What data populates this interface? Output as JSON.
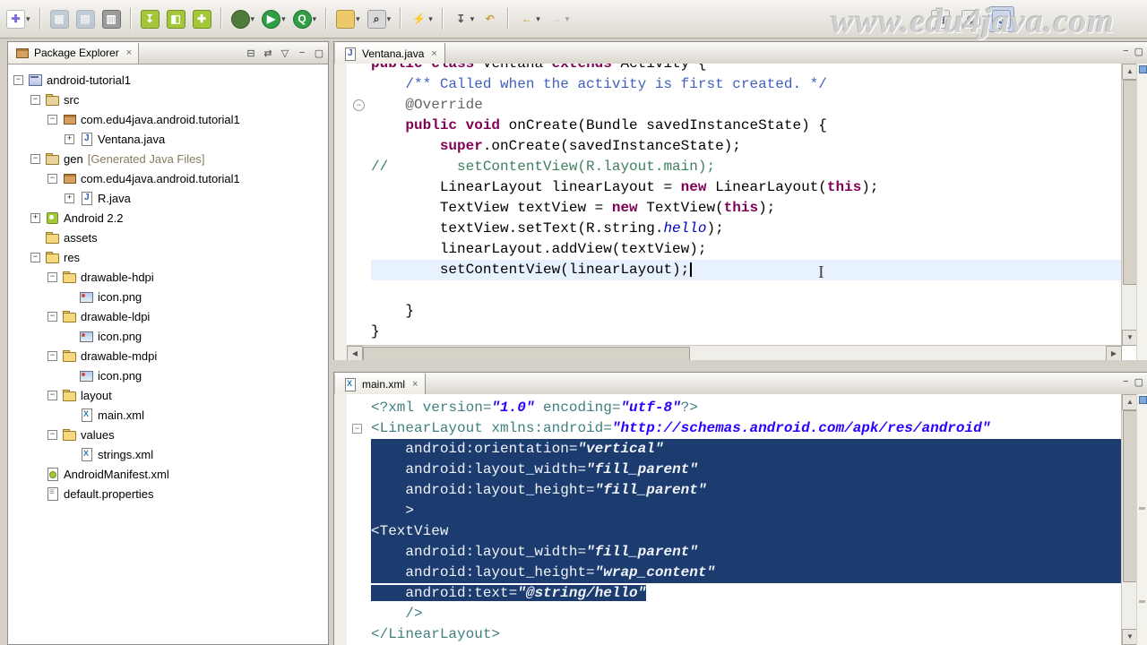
{
  "watermark": "www.edu4java.com",
  "palette": {
    "keyword": "#7f0055",
    "comment": "#3f7f5f",
    "javadoc": "#3f5fbf",
    "annotation": "#646464",
    "field": "#0000c0",
    "xml_tag": "#3f7f7f",
    "xml_attr": "#3f7f7f",
    "xml_value": "#2a00ff",
    "selection_bg": "#1c3b6e",
    "current_line": "#e8f2fe",
    "android_green": "#a4c639",
    "run_green": "#2f9e44"
  },
  "toolbar": {
    "items": [
      {
        "name": "new-wizard",
        "glyph": "✚",
        "fg": "#7a6ad8",
        "bg": "#ffffff",
        "dropdown": true
      },
      {
        "sep": true
      },
      {
        "name": "save",
        "glyph": "▦",
        "fg": "#ffffff",
        "bg": "#8fa8c8",
        "disabled": true
      },
      {
        "name": "save-all",
        "glyph": "▤",
        "fg": "#ffffff",
        "bg": "#8fa8c8",
        "disabled": true
      },
      {
        "name": "print",
        "glyph": "▥",
        "fg": "#ffffff",
        "bg": "#9b9b9b"
      },
      {
        "sep": true
      },
      {
        "name": "android-sdk-manager",
        "glyph": "↧",
        "fg": "#ffffff",
        "bg": "#a4c639"
      },
      {
        "name": "android-ddms",
        "glyph": "◧",
        "fg": "#ffffff",
        "bg": "#a4c639"
      },
      {
        "name": "new-android-project",
        "glyph": "✚",
        "fg": "#ffffff",
        "bg": "#a4c639"
      },
      {
        "sep": true
      },
      {
        "name": "debug",
        "glyph": "",
        "fg": "#ffffff",
        "bg": "#4e7b3a",
        "round": true,
        "dropdown": true
      },
      {
        "name": "run",
        "glyph": "▶",
        "fg": "#ffffff",
        "bg": "#2f9e44",
        "round": true,
        "dropdown": true
      },
      {
        "name": "run-history",
        "glyph": "Q",
        "fg": "#ffffff",
        "bg": "#2f9e44",
        "round": true,
        "dropdown": true
      },
      {
        "sep": true
      },
      {
        "name": "open-resource",
        "glyph": "",
        "fg": "#7a5c20",
        "bg": "#eec96a",
        "dropdown": true
      },
      {
        "name": "search",
        "glyph": "⌕",
        "fg": "#333333",
        "bg": "#d9d9d9",
        "dropdown": true
      },
      {
        "sep": true
      },
      {
        "name": "external-tools",
        "glyph": "⚡",
        "fg": "#dfa511",
        "bg": "none",
        "dropdown": true
      },
      {
        "sep": true
      },
      {
        "name": "next-annotation",
        "glyph": "↧",
        "fg": "#555555",
        "bg": "none",
        "dropdown": true
      },
      {
        "name": "last-edit-location",
        "glyph": "↶",
        "fg": "#c8a23a",
        "bg": "none"
      },
      {
        "sep": true
      },
      {
        "name": "back",
        "glyph": "←",
        "fg": "#c8941e",
        "bg": "none",
        "dropdown": true
      },
      {
        "name": "forward",
        "glyph": "→",
        "fg": "#b0b0b0",
        "bg": "none",
        "dropdown": true,
        "disabled": true
      }
    ],
    "right_items": [
      {
        "name": "open-perspective",
        "glyph": "⊞",
        "fg": "#44507a",
        "bg": "#eceae4"
      },
      {
        "name": "preferences",
        "glyph": "⚙",
        "fg": "#555f78",
        "bg": "#eceae4"
      },
      {
        "name": "java-perspective",
        "glyph": "J",
        "fg": "#1f4fa0",
        "bg": "#ccd7eb",
        "active": true
      }
    ]
  },
  "package_explorer": {
    "title": "Package Explorer",
    "close_glyph": "×",
    "header_icons": [
      {
        "name": "collapse-all",
        "glyph": "⊟"
      },
      {
        "name": "link-with-editor",
        "glyph": "⇄"
      },
      {
        "name": "view-menu",
        "glyph": "▽"
      },
      {
        "name": "minimize",
        "glyph": "−"
      },
      {
        "name": "maximize",
        "glyph": "▢"
      }
    ],
    "tree": [
      {
        "label": "android-tutorial1",
        "level": 0,
        "expander": "minus",
        "icon": "project"
      },
      {
        "label": "src",
        "level": 1,
        "expander": "minus",
        "icon": "srcfolder"
      },
      {
        "label": "com.edu4java.android.tutorial1",
        "level": 2,
        "expander": "minus",
        "icon": "package"
      },
      {
        "label": "Ventana.java",
        "level": 3,
        "expander": "plus",
        "icon": "java"
      },
      {
        "label": "gen",
        "suffix": "[Generated Java Files]",
        "level": 1,
        "expander": "minus",
        "icon": "srcfolder"
      },
      {
        "label": "com.edu4java.android.tutorial1",
        "level": 2,
        "expander": "minus",
        "icon": "package"
      },
      {
        "label": "R.java",
        "level": 3,
        "expander": "plus",
        "icon": "java"
      },
      {
        "label": "Android 2.2",
        "level": 1,
        "expander": "plus",
        "icon": "androidlib"
      },
      {
        "label": "assets",
        "level": 1,
        "expander": "none",
        "icon": "folder"
      },
      {
        "label": "res",
        "level": 1,
        "expander": "minus",
        "icon": "folder"
      },
      {
        "label": "drawable-hdpi",
        "level": 2,
        "expander": "minus",
        "icon": "folder"
      },
      {
        "label": "icon.png",
        "level": 3,
        "expander": "none",
        "icon": "image"
      },
      {
        "label": "drawable-ldpi",
        "level": 2,
        "expander": "minus",
        "icon": "folder"
      },
      {
        "label": "icon.png",
        "level": 3,
        "expander": "none",
        "icon": "image"
      },
      {
        "label": "drawable-mdpi",
        "level": 2,
        "expander": "minus",
        "icon": "folder"
      },
      {
        "label": "icon.png",
        "level": 3,
        "expander": "none",
        "icon": "image"
      },
      {
        "label": "layout",
        "level": 2,
        "expander": "minus",
        "icon": "folder"
      },
      {
        "label": "main.xml",
        "level": 3,
        "expander": "none",
        "icon": "xml"
      },
      {
        "label": "values",
        "level": 2,
        "expander": "minus",
        "icon": "folder"
      },
      {
        "label": "strings.xml",
        "level": 3,
        "expander": "none",
        "icon": "xml"
      },
      {
        "label": "AndroidManifest.xml",
        "level": 1,
        "expander": "none",
        "icon": "manifest"
      },
      {
        "label": "default.properties",
        "level": 1,
        "expander": "none",
        "icon": "properties"
      }
    ]
  },
  "java_editor": {
    "tab_label": "Ventana.java",
    "lines": [
      {
        "t": [
          [
            "kw",
            "public"
          ],
          [
            "p",
            " "
          ],
          [
            "kw",
            "class"
          ],
          [
            "p",
            " Ventana "
          ],
          [
            "kw",
            "extends"
          ],
          [
            "p",
            " Activity {"
          ]
        ]
      },
      {
        "t": [
          [
            "doc",
            "    /** Called when the activity is first created. */"
          ]
        ]
      },
      {
        "t": [
          [
            "ann",
            "    @Override"
          ]
        ],
        "fold": true
      },
      {
        "t": [
          [
            "p",
            "    "
          ],
          [
            "kw",
            "public"
          ],
          [
            "p",
            " "
          ],
          [
            "kw",
            "void"
          ],
          [
            "p",
            " onCreate(Bundle savedInstanceState) {"
          ]
        ],
        "marker": "arrow"
      },
      {
        "t": [
          [
            "p",
            "        "
          ],
          [
            "kw",
            "super"
          ],
          [
            "p",
            ".onCreate(savedInstanceState);"
          ]
        ]
      },
      {
        "t": [
          [
            "cmt",
            "//        setContentView(R.layout.main);"
          ]
        ]
      },
      {
        "t": [
          [
            "p",
            "        LinearLayout linearLayout = "
          ],
          [
            "kw",
            "new"
          ],
          [
            "p",
            " LinearLayout("
          ],
          [
            "kw",
            "this"
          ],
          [
            "p",
            ");"
          ]
        ]
      },
      {
        "t": [
          [
            "p",
            "        TextView textView = "
          ],
          [
            "kw",
            "new"
          ],
          [
            "p",
            " TextView("
          ],
          [
            "kw",
            "this"
          ],
          [
            "p",
            ");"
          ]
        ]
      },
      {
        "t": [
          [
            "p",
            "        textView.setText(R.string."
          ],
          [
            "fld",
            "hello"
          ],
          [
            "p",
            ");"
          ]
        ]
      },
      {
        "t": [
          [
            "p",
            "        linearLayout.addView(textView);"
          ]
        ]
      },
      {
        "t": [
          [
            "p",
            "        setContentView(linearLayout);"
          ]
        ],
        "current": true,
        "caret": true
      },
      {
        "t": [
          [
            "p",
            ""
          ]
        ]
      },
      {
        "t": [
          [
            "p",
            "    }"
          ]
        ]
      },
      {
        "t": [
          [
            "p",
            "}"
          ]
        ]
      }
    ]
  },
  "xml_editor": {
    "tab_label": "main.xml",
    "lines": [
      {
        "t": [
          [
            "tag",
            "<?xml "
          ],
          [
            "attr",
            "version="
          ],
          [
            "val",
            "\"1.0\""
          ],
          [
            "attr",
            " encoding="
          ],
          [
            "val",
            "\"utf-8\""
          ],
          [
            "tag",
            "?>"
          ]
        ]
      },
      {
        "t": [
          [
            "tag",
            "<LinearLayout "
          ],
          [
            "attr",
            "xmlns:android="
          ],
          [
            "val",
            "\"http://schemas.android.com/apk/res/android\""
          ]
        ],
        "fold": true
      },
      {
        "t": [
          [
            "attr",
            "    android:orientation="
          ],
          [
            "val",
            "\"vertical\""
          ]
        ],
        "sel": "full"
      },
      {
        "t": [
          [
            "attr",
            "    android:layout_width="
          ],
          [
            "val",
            "\"fill_parent\""
          ]
        ],
        "sel": "full"
      },
      {
        "t": [
          [
            "attr",
            "    android:layout_height="
          ],
          [
            "val",
            "\"fill_parent\""
          ]
        ],
        "sel": "full"
      },
      {
        "t": [
          [
            "tag",
            "    >"
          ]
        ],
        "sel": "full"
      },
      {
        "t": [
          [
            "tag",
            "<TextView"
          ]
        ],
        "sel": "full"
      },
      {
        "t": [
          [
            "attr",
            "    android:layout_width="
          ],
          [
            "val",
            "\"fill_parent\""
          ]
        ],
        "sel": "full"
      },
      {
        "t": [
          [
            "attr",
            "    android:layout_height="
          ],
          [
            "val",
            "\"wrap_content\""
          ]
        ],
        "sel": "full"
      },
      {
        "t": [
          [
            "attr",
            "    android:text="
          ],
          [
            "val",
            "\"@string/hello\""
          ]
        ],
        "sel": "text"
      },
      {
        "t": [
          [
            "tag",
            "    />"
          ]
        ]
      },
      {
        "t": [
          [
            "tag",
            "</LinearLayout>"
          ]
        ]
      }
    ]
  }
}
